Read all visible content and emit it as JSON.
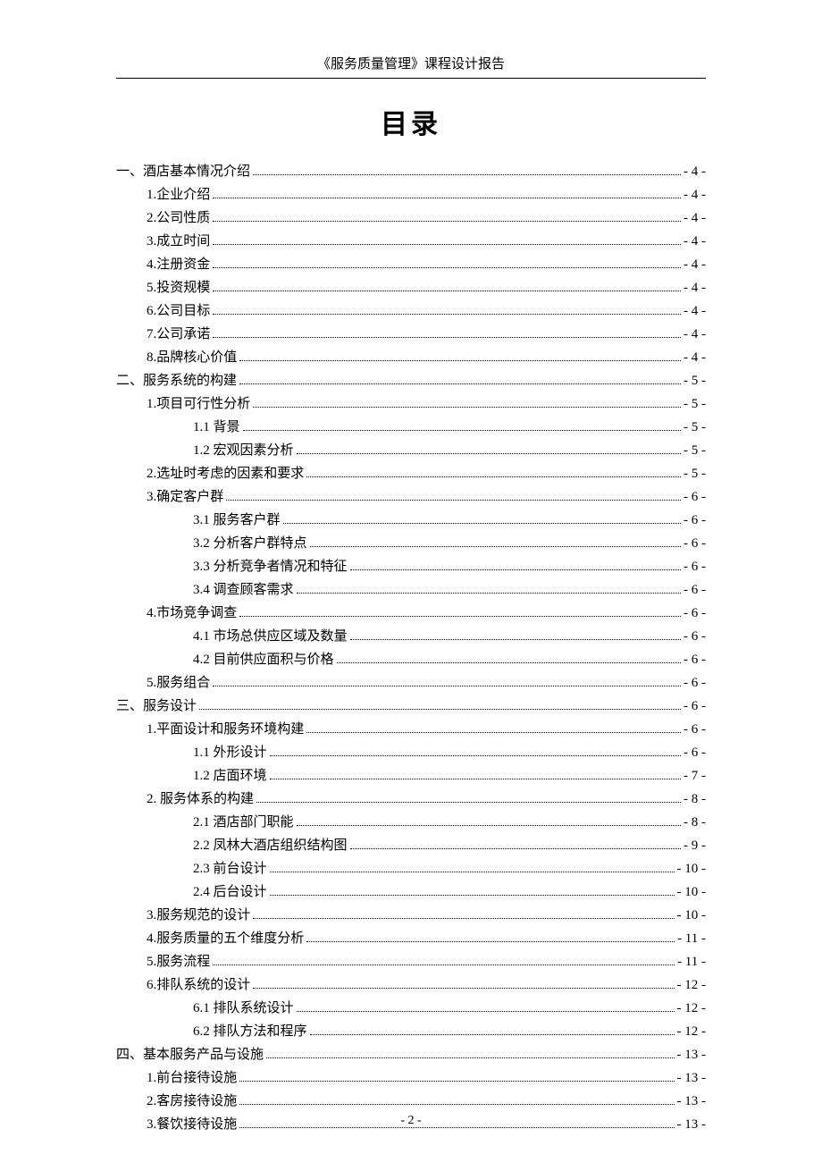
{
  "header": "《服务质量管理》课程设计报告",
  "title": "目录",
  "footer": "- 2 -",
  "toc": [
    {
      "level": 0,
      "label": "一、酒店基本情况介绍",
      "page": "- 4 -"
    },
    {
      "level": 1,
      "label": "1.企业介绍",
      "page": "- 4 -"
    },
    {
      "level": 1,
      "label": "2.公司性质",
      "page": "- 4 -"
    },
    {
      "level": 1,
      "label": "3.成立时间",
      "page": "- 4 -"
    },
    {
      "level": 1,
      "label": "4.注册资金",
      "page": "- 4 -"
    },
    {
      "level": 1,
      "label": "5.投资规模",
      "page": "- 4 -"
    },
    {
      "level": 1,
      "label": "6.公司目标",
      "page": "- 4 -"
    },
    {
      "level": 1,
      "label": "7.公司承诺",
      "page": "- 4 -"
    },
    {
      "level": 1,
      "label": "8.品牌核心价值",
      "page": "- 4 -"
    },
    {
      "level": 0,
      "label": "二、服务系统的构建",
      "page": "- 5 -"
    },
    {
      "level": 1,
      "label": "1.项目可行性分析",
      "page": "- 5 -"
    },
    {
      "level": 2,
      "label": "1.1 背景",
      "page": "- 5 -"
    },
    {
      "level": 2,
      "label": "1.2 宏观因素分析",
      "page": "- 5 -"
    },
    {
      "level": 1,
      "label": "2.选址时考虑的因素和要求",
      "page": "- 5 -"
    },
    {
      "level": 1,
      "label": "3.确定客户群",
      "page": "- 6 -"
    },
    {
      "level": 2,
      "label": "3.1 服务客户群",
      "page": "- 6 -"
    },
    {
      "level": 2,
      "label": "3.2 分析客户群特点",
      "page": "- 6 -"
    },
    {
      "level": 2,
      "label": "3.3 分析竞争者情况和特征",
      "page": "- 6 -"
    },
    {
      "level": 2,
      "label": "3.4 调查顾客需求",
      "page": "- 6 -"
    },
    {
      "level": 1,
      "label": "4.市场竞争调查",
      "page": "- 6 -"
    },
    {
      "level": 2,
      "label": "4.1 市场总供应区域及数量",
      "page": "- 6 -"
    },
    {
      "level": 2,
      "label": "4.2 目前供应面积与价格",
      "page": "- 6 -"
    },
    {
      "level": 1,
      "label": "5.服务组合",
      "page": "- 6 -"
    },
    {
      "level": 0,
      "label": "三、服务设计",
      "page": "- 6 -"
    },
    {
      "level": 1,
      "label": "1.平面设计和服务环境构建",
      "page": "- 6 -"
    },
    {
      "level": 2,
      "label": "1.1 外形设计",
      "page": "- 6 -"
    },
    {
      "level": 2,
      "label": "1.2 店面环境",
      "page": "- 7 -"
    },
    {
      "level": 1,
      "label": "2. 服务体系的构建",
      "page": "- 8 -"
    },
    {
      "level": 2,
      "label": "2.1 酒店部门职能",
      "page": "- 8 -"
    },
    {
      "level": 2,
      "label": "2.2 凤林大酒店组织结构图",
      "page": "- 9 -"
    },
    {
      "level": 2,
      "label": "2.3 前台设计",
      "page": "- 10 -"
    },
    {
      "level": 2,
      "label": "2.4 后台设计",
      "page": "- 10 -"
    },
    {
      "level": 1,
      "label": "3.服务规范的设计",
      "page": "- 10 -"
    },
    {
      "level": 1,
      "label": "4.服务质量的五个维度分析",
      "page": "- 11 -"
    },
    {
      "level": 1,
      "label": "5.服务流程",
      "page": "- 11 -"
    },
    {
      "level": 1,
      "label": "6.排队系统的设计",
      "page": "- 12 -"
    },
    {
      "level": 2,
      "label": "6.1 排队系统设计",
      "page": "- 12 -"
    },
    {
      "level": 2,
      "label": "6.2 排队方法和程序",
      "page": "- 12 -"
    },
    {
      "level": 0,
      "label": "四、基本服务产品与设施",
      "page": "- 13 -"
    },
    {
      "level": 1,
      "label": "1.前台接待设施",
      "page": "- 13 -"
    },
    {
      "level": 1,
      "label": "2.客房接待设施",
      "page": "- 13 -"
    },
    {
      "level": 1,
      "label": "3.餐饮接待设施",
      "page": "- 13 -"
    }
  ]
}
